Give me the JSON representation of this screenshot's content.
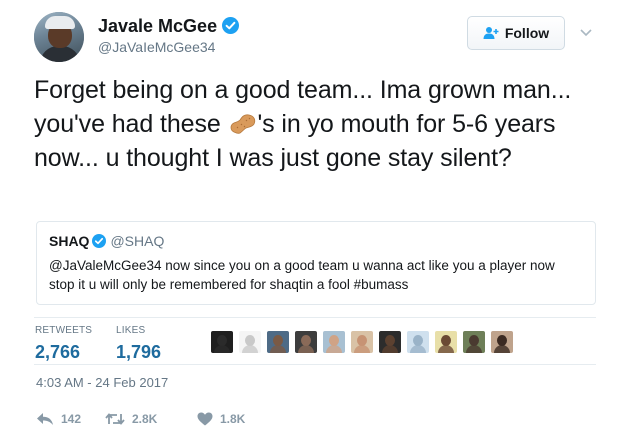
{
  "author": {
    "name": "Javale McGee",
    "handle": "@JaVaIeMcGee34",
    "avatar_icon": "user-avatar",
    "verified_icon": "verified-badge-icon"
  },
  "follow_button": {
    "label": "Follow",
    "icon": "add-user-icon"
  },
  "menu_icon": "chevron-down-icon",
  "tweet": {
    "text_before_emoji": "Forget being on a good team... Ima grown man... you've had these ",
    "emoji": "peanut-emoji",
    "text_after_emoji": "'s in yo mouth for 5-6 years now... u thought I was just gone stay silent?"
  },
  "quoted_tweet": {
    "name": "SHAQ",
    "handle": "@SHAQ",
    "text": "@JaValeMcGee34 now since you on a good team u wanna act like you a player now stop it u will only be remembered for shaqtin a fool #bumass"
  },
  "stats": {
    "retweets_label": "RETWEETS",
    "retweets_value": "2,766",
    "likes_label": "LIKES",
    "likes_value": "1,796"
  },
  "likers": [
    {
      "face": "#2b2b2b",
      "bg": "#1f1f1f"
    },
    {
      "face": "#c9c9c9",
      "bg": "#f5f5f5"
    },
    {
      "face": "#7a5a45",
      "bg": "#4e6b86"
    },
    {
      "face": "#8a6a58",
      "bg": "#3d3d3d"
    },
    {
      "face": "#d0a386",
      "bg": "#a8c0d2"
    },
    {
      "face": "#c79374",
      "bg": "#d9c2a6"
    },
    {
      "face": "#5c4130",
      "bg": "#2c2c2c"
    },
    {
      "face": "#9ab3c8",
      "bg": "#cfe0ee"
    },
    {
      "face": "#6b4a34",
      "bg": "#e8dfa8"
    },
    {
      "face": "#4a3a30",
      "bg": "#6e7f58"
    },
    {
      "face": "#3b2a22",
      "bg": "#bfa38c"
    }
  ],
  "timestamp": "4:03 AM - 24 Feb 2017",
  "actions": {
    "reply_count": "142",
    "retweet_count": "2.8K",
    "like_count": "1.8K"
  },
  "colors": {
    "accent": "#1da1f2",
    "stat_value": "#1e6b9e",
    "muted": "#657786",
    "action": "#8899a6"
  }
}
